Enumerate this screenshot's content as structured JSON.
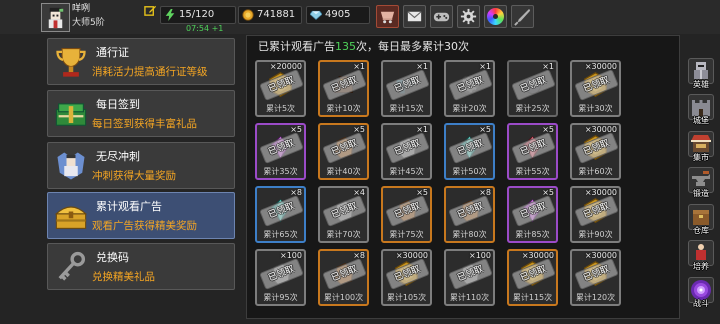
{
  "player": {
    "name": "咩咧",
    "rank": "大师5阶",
    "avatar_icon": "avatar-icon"
  },
  "resources": {
    "energy": {
      "value": "15/120",
      "timer": "07:54 +1",
      "icon": "lightning-icon"
    },
    "gold": {
      "value": "741881",
      "icon": "coin-icon"
    },
    "gems": {
      "value": "4905",
      "icon": "gem-icon"
    }
  },
  "toolbar": [
    {
      "icon": "shop-cart-icon"
    },
    {
      "icon": "mail-icon"
    },
    {
      "icon": "gamepad-icon"
    },
    {
      "icon": "gear-icon"
    },
    {
      "icon": "color-wheel-icon"
    },
    {
      "icon": "quill-icon"
    }
  ],
  "menu": [
    {
      "title": "通行证",
      "subtitle": "消耗活力提高通行证等级",
      "icon": "trophy-icon",
      "selected": false
    },
    {
      "title": "每日签到",
      "subtitle": "每日签到获得丰富礼品",
      "icon": "green-book-icon",
      "selected": false
    },
    {
      "title": "无尽冲刺",
      "subtitle": "冲刺获得大量奖励",
      "icon": "knight-icon",
      "selected": false
    },
    {
      "title": "累计观看广告",
      "subtitle": "观看广告获得精美奖励",
      "icon": "gold-chest-icon",
      "selected": true
    },
    {
      "title": "兑换码",
      "subtitle": "兑换精美礼品",
      "icon": "key-icon",
      "selected": false
    }
  ],
  "ad_panel": {
    "header_prefix": "已累计观看广告",
    "count": "135",
    "header_suffix": "次，每日最多累计30次",
    "claimed_label": "已领取",
    "rewards": [
      {
        "amount": "×20000",
        "label": "累计5次",
        "icon": "coin-icon",
        "border_color": "#7d7d7d",
        "claimed": true
      },
      {
        "amount": "×1",
        "label": "累计10次",
        "icon": "bag-icon",
        "border_color": "#c8781e",
        "claimed": true
      },
      {
        "amount": "×1",
        "label": "累计15次",
        "icon": "gun-icon",
        "border_color": "#7d7d7d",
        "claimed": true
      },
      {
        "amount": "×1",
        "label": "累计20次",
        "icon": "gear-part-icon",
        "border_color": "#7d7d7d",
        "claimed": true
      },
      {
        "amount": "×1",
        "label": "累计25次",
        "icon": "dark-orb-icon",
        "border_color": "#666666",
        "claimed": true
      },
      {
        "amount": "×30000",
        "label": "累计30次",
        "icon": "coin-icon",
        "border_color": "#7d7d7d",
        "claimed": true
      },
      {
        "amount": "×5",
        "label": "累计35次",
        "icon": "purple-gem-icon",
        "border_color": "#9b4bc8",
        "claimed": true
      },
      {
        "amount": "×5",
        "label": "累计40次",
        "icon": "ore-icon",
        "border_color": "#c8781e",
        "claimed": true
      },
      {
        "amount": "×1",
        "label": "累计45次",
        "icon": "silver-ore-icon",
        "border_color": "#7d7d7d",
        "claimed": true
      },
      {
        "amount": "×5",
        "label": "累计50次",
        "icon": "teal-crystal-icon",
        "border_color": "#3d7fc8",
        "claimed": true
      },
      {
        "amount": "×5",
        "label": "累计55次",
        "icon": "red-crystal-icon",
        "border_color": "#9b4bc8",
        "claimed": true
      },
      {
        "amount": "×30000",
        "label": "累计60次",
        "icon": "coin-icon",
        "border_color": "#7d7d7d",
        "claimed": true
      },
      {
        "amount": "×8",
        "label": "累计65次",
        "icon": "teal-crystal-icon",
        "border_color": "#3d7fc8",
        "claimed": true
      },
      {
        "amount": "×4",
        "label": "累计70次",
        "icon": "silver-ore-icon",
        "border_color": "#7d7d7d",
        "claimed": true
      },
      {
        "amount": "×5",
        "label": "累计75次",
        "icon": "ore-icon",
        "border_color": "#c8781e",
        "claimed": true
      },
      {
        "amount": "×8",
        "label": "累计80次",
        "icon": "ore-icon",
        "border_color": "#c8781e",
        "claimed": true
      },
      {
        "amount": "×5",
        "label": "累计85次",
        "icon": "purple-gem-icon",
        "border_color": "#9b4bc8",
        "claimed": true
      },
      {
        "amount": "×30000",
        "label": "累计90次",
        "icon": "coin-icon",
        "border_color": "#7d7d7d",
        "claimed": true
      },
      {
        "amount": "×100",
        "label": "累计95次",
        "icon": "silver-ore-icon",
        "border_color": "#7d7d7d",
        "claimed": true
      },
      {
        "amount": "×8",
        "label": "累计100次",
        "icon": "ore-icon",
        "border_color": "#c8781e",
        "claimed": true
      },
      {
        "amount": "×30000",
        "label": "累计105次",
        "icon": "coin-icon",
        "border_color": "#7d7d7d",
        "claimed": true
      },
      {
        "amount": "×100",
        "label": "累计110次",
        "icon": "silver-ore-icon",
        "border_color": "#7d7d7d",
        "claimed": true
      },
      {
        "amount": "×30000",
        "label": "累计115次",
        "icon": "coin-icon",
        "border_color": "#c8781e",
        "claimed": true
      },
      {
        "amount": "×30000",
        "label": "累计120次",
        "icon": "coin-icon",
        "border_color": "#7d7d7d",
        "claimed": true
      }
    ]
  },
  "sidebar": [
    {
      "label": "英雄",
      "icon": "hero-icon"
    },
    {
      "label": "城堡",
      "icon": "castle-icon"
    },
    {
      "label": "集市",
      "icon": "market-icon"
    },
    {
      "label": "锻造",
      "icon": "anvil-icon"
    },
    {
      "label": "仓库",
      "icon": "warehouse-icon"
    },
    {
      "label": "培养",
      "icon": "training-icon"
    },
    {
      "label": "战斗",
      "icon": "portal-icon"
    }
  ]
}
